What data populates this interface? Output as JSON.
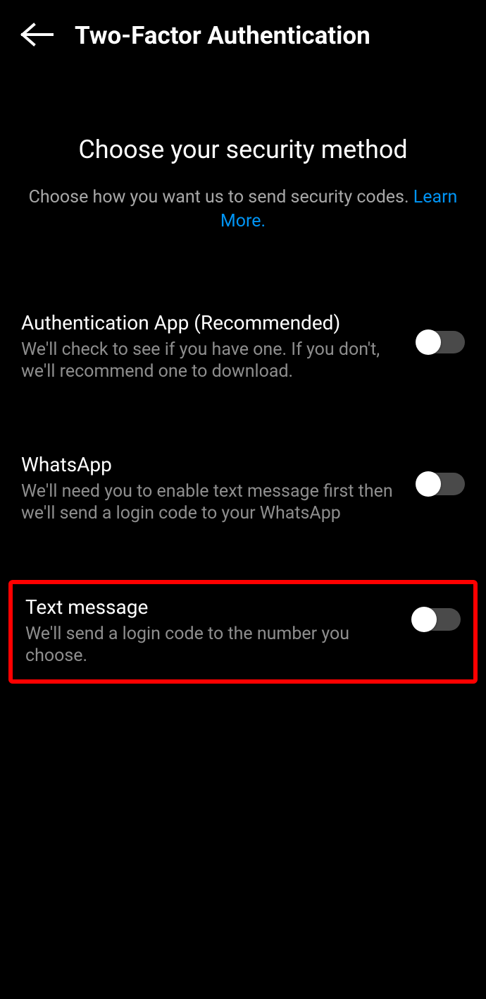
{
  "header": {
    "title": "Two-Factor Authentication"
  },
  "hero": {
    "title": "Choose your security method",
    "subtitle": "Choose how you want us to send security codes.",
    "learn_more": "Learn More."
  },
  "options": [
    {
      "title": "Authentication App (Recommended)",
      "desc": "We'll check to see if you have one. If you don't, we'll recommend one to download.",
      "enabled": false
    },
    {
      "title": "WhatsApp",
      "desc": "We'll need you to enable text message first then we'll send a login code to your WhatsApp",
      "enabled": false
    },
    {
      "title": "Text message",
      "desc": "We'll send a login code to the number you choose.",
      "enabled": false,
      "highlighted": true
    }
  ]
}
